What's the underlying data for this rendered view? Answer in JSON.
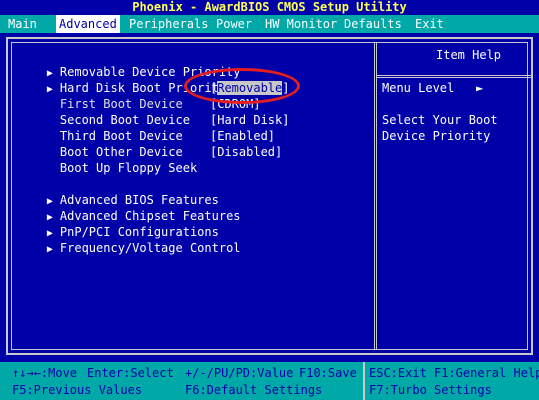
{
  "title_bar": "Phoenix - AwardBIOS CMOS Setup Utility",
  "menu": [
    {
      "label": "Main"
    },
    {
      "label": "Advanced"
    },
    {
      "label": "Peripherals"
    },
    {
      "label": "Power"
    },
    {
      "label": "HW Monitor"
    },
    {
      "label": "Defaults"
    },
    {
      "label": "Exit"
    }
  ],
  "boot_items": [
    {
      "label": "Removable Device Priority",
      "value": ""
    },
    {
      "label": "Hard Disk Boot Priority",
      "value": ""
    },
    {
      "label": "First Boot Device",
      "value": "[Removable]"
    },
    {
      "label": "Second Boot Device",
      "value": "[CDROM]"
    },
    {
      "label": "Third Boot Device",
      "value": "[Hard Disk]"
    },
    {
      "label": "Boot Other Device",
      "value": "[Enabled]"
    },
    {
      "label": "Boot Up Floppy Seek",
      "value": "[Disabled]"
    }
  ],
  "first_boot_value_text": "Removable",
  "submenus": [
    {
      "label": "Advanced BIOS Features"
    },
    {
      "label": "Advanced Chipset Features"
    },
    {
      "label": "PnP/PCI Configurations"
    },
    {
      "label": "Frequency/Voltage Control"
    }
  ],
  "help": {
    "title": "Item Help",
    "menu_level_label": "Menu Level",
    "menu_level_arrow": "►",
    "text_line1": "Select Your Boot",
    "text_line2": "Device Priority"
  },
  "status": {
    "move": "↑↓→←:Move",
    "enter": "Enter:Select",
    "value": "+/-/PU/PD:Value",
    "save": "F10:Save",
    "exit": "ESC:Exit",
    "help": "F1:General Help",
    "prev": "F5:Previous Values",
    "defaults": "F6:Default Settings",
    "turbo": "F7:Turbo Settings"
  },
  "colors": {
    "background": "#0000a8",
    "menu_bar": "#00a8a8",
    "title": "#ffff55",
    "highlight_circle": "#e41e1e"
  }
}
